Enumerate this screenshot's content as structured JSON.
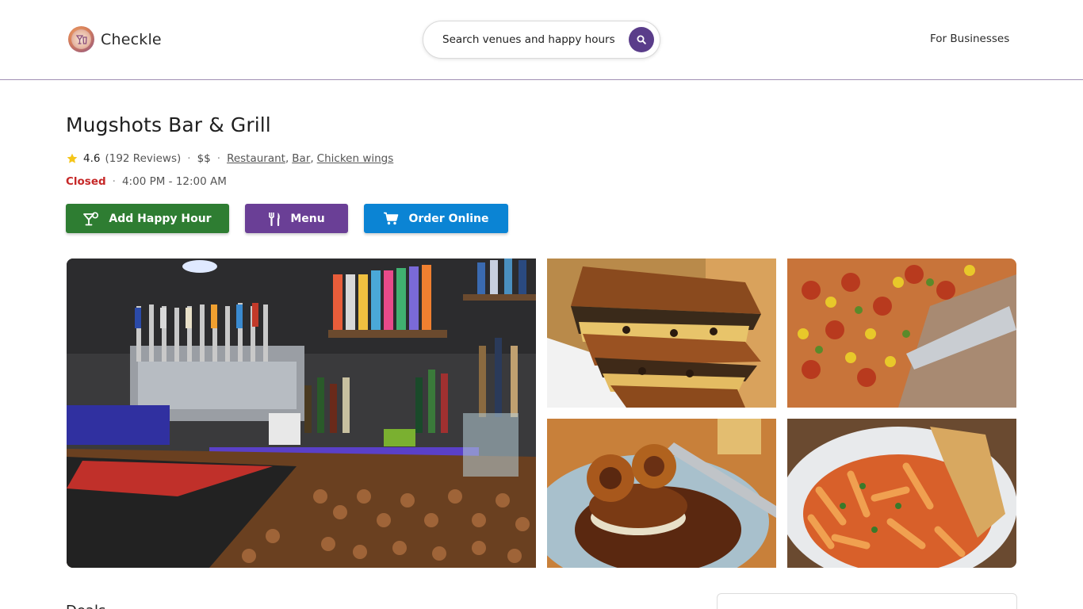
{
  "header": {
    "brand_name": "Checkle",
    "search_placeholder": "Search venues and happy hours",
    "for_businesses": "For Businesses"
  },
  "venue": {
    "name": "Mugshots Bar & Grill",
    "rating": "4.6",
    "reviews": "(192 Reviews)",
    "price": "$$",
    "categories": [
      "Restaurant",
      "Bar",
      "Chicken wings"
    ],
    "status": "Closed",
    "hours": "4:00 PM - 12:00 AM"
  },
  "actions": {
    "add_happy_hour": "Add Happy Hour",
    "menu": "Menu",
    "order_online": "Order Online"
  },
  "colors": {
    "brand_purple": "#5a3d8a",
    "happy_hour_green": "#2e7d32",
    "menu_purple": "#6a3f96",
    "order_blue": "#0b84d4",
    "closed_red": "#c62828",
    "star_yellow": "#f5c518"
  },
  "icons": {
    "brand": "cocktail-logo-icon",
    "search": "search-icon",
    "star": "star-icon",
    "happy_hour": "cocktail-icon",
    "menu": "fork-knife-icon",
    "order": "cart-icon"
  },
  "gallery": {
    "photos": [
      "bar-interior-photo",
      "grilled-sandwich-photo",
      "pizza-photo",
      "onion-ring-burger-photo",
      "pasta-photo"
    ]
  },
  "section": {
    "heading": "Deals"
  }
}
